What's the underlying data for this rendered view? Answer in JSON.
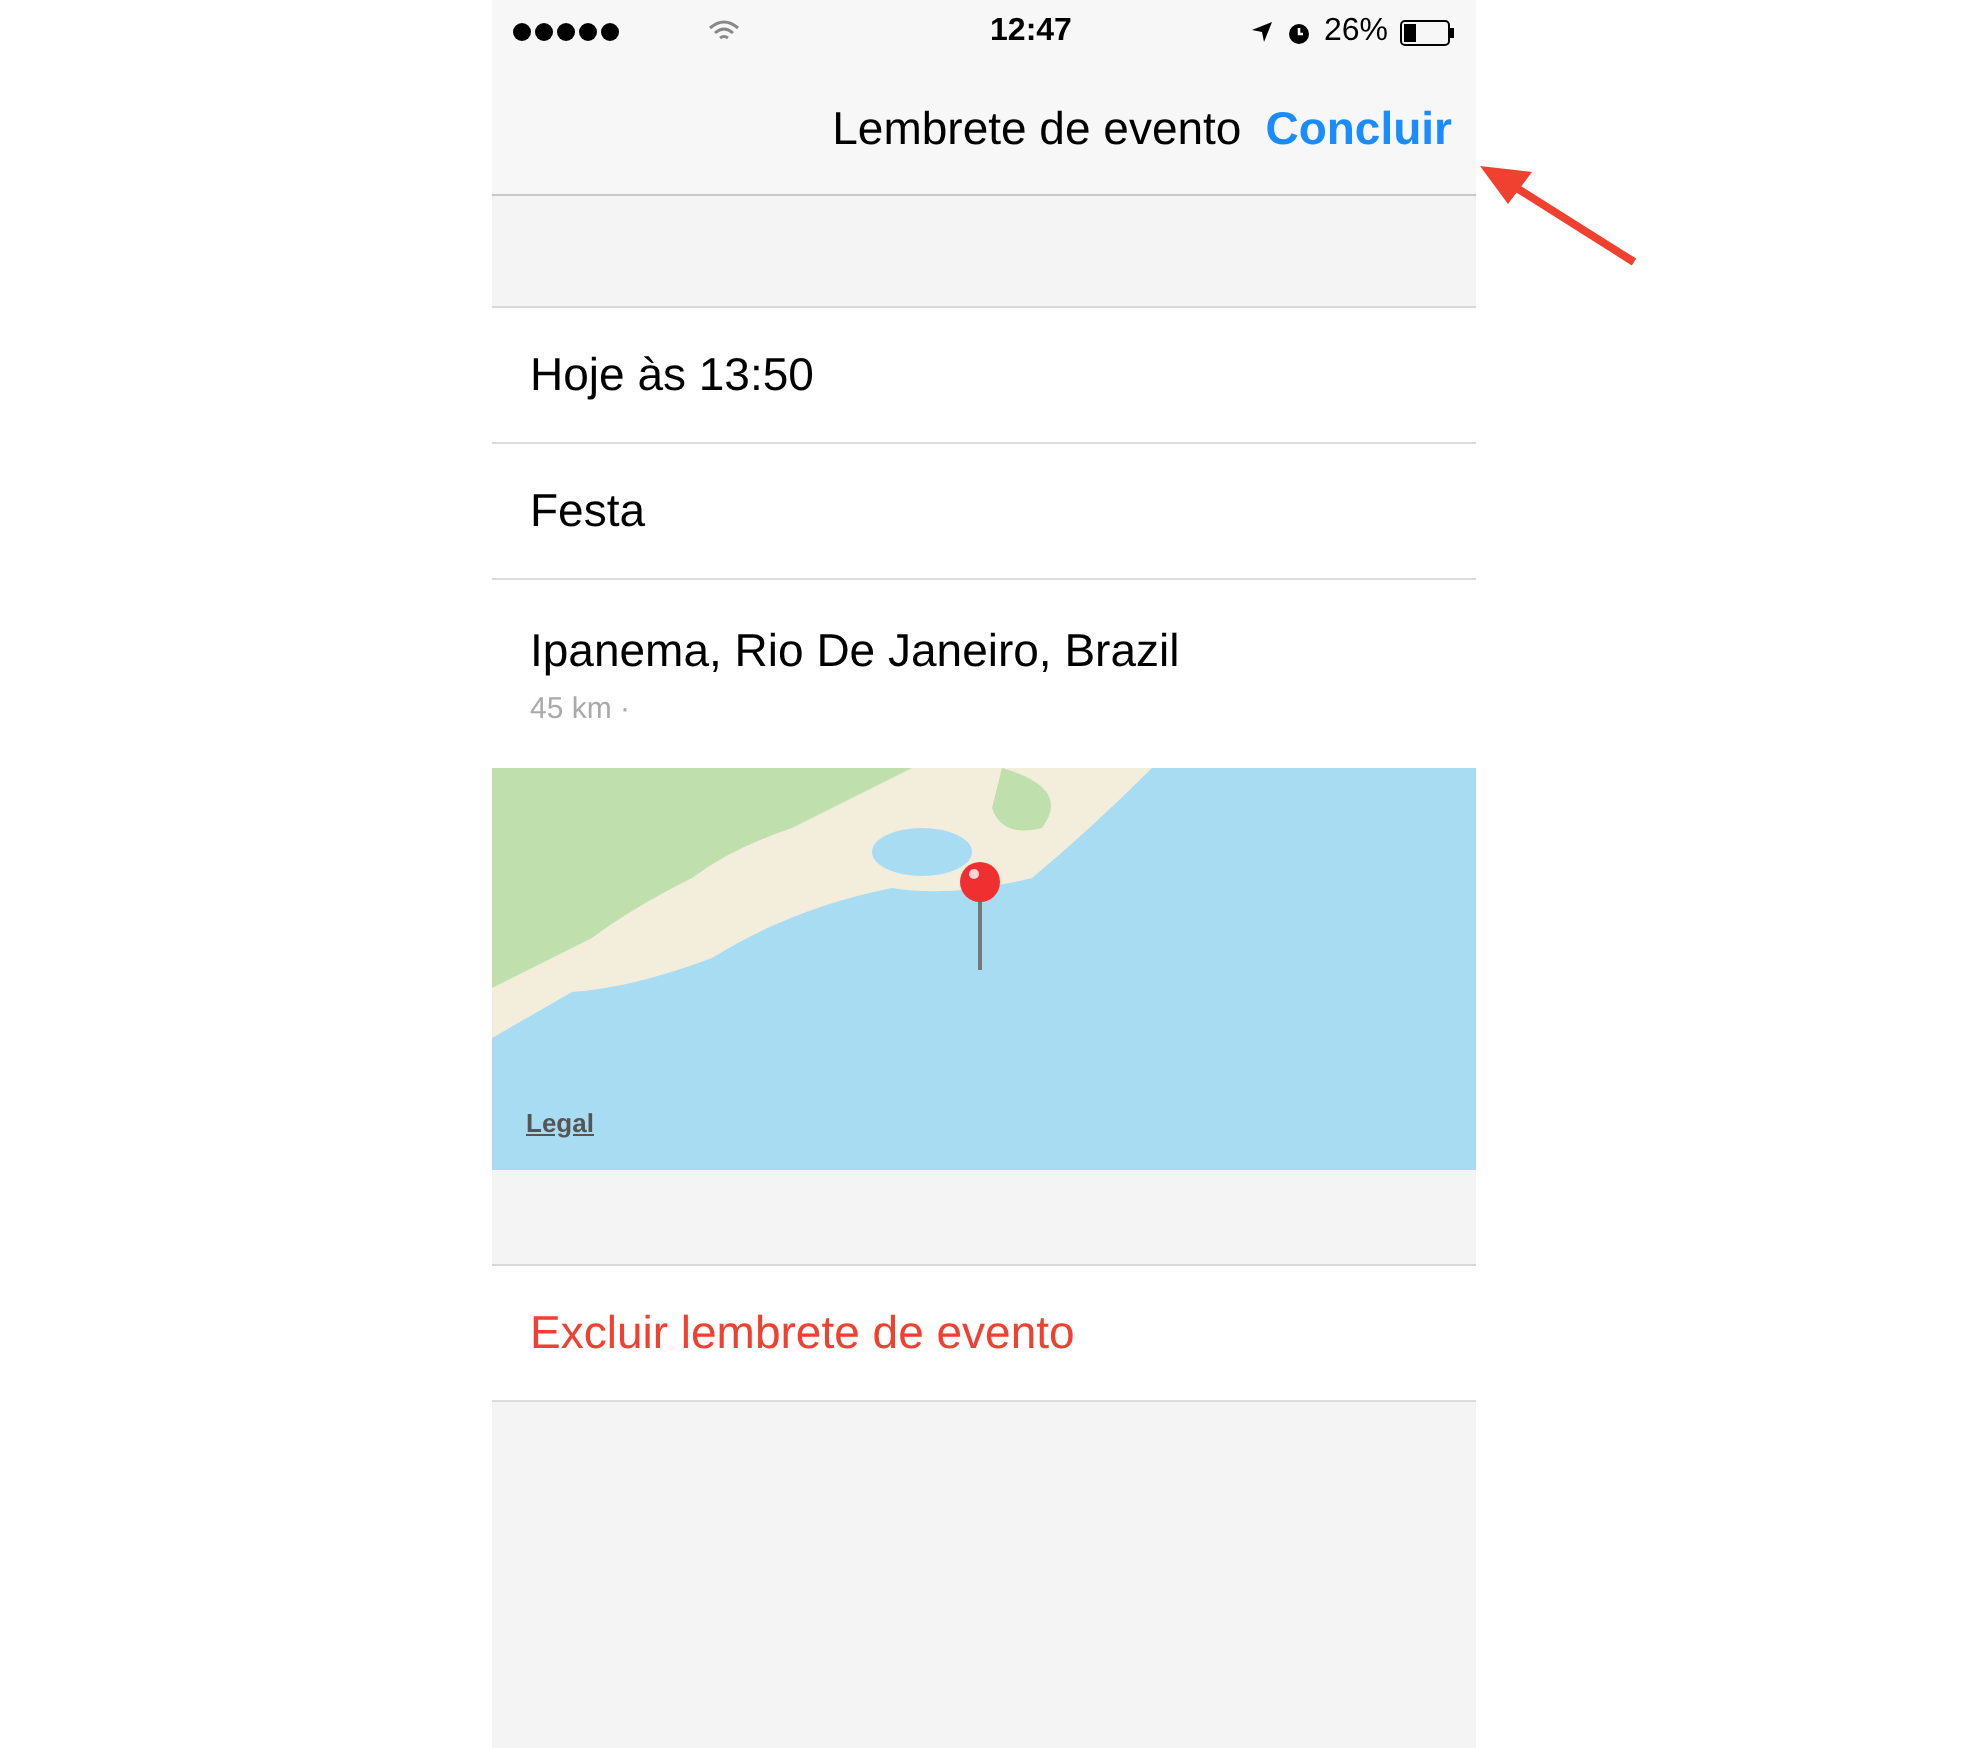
{
  "status_bar": {
    "time": "12:47",
    "battery": "26%"
  },
  "nav_bar": {
    "title": "Lembrete de evento",
    "done": "Concluir"
  },
  "rows": [
    {
      "text": "Hoje às 13:50"
    },
    {
      "text": "Festa"
    }
  ],
  "location": {
    "name": "Ipanema, Rio De Janeiro, Brazil",
    "distance": "45 km ·"
  },
  "map": {
    "legal": "Legal"
  },
  "delete_button": "Excluir lembrete de evento"
}
